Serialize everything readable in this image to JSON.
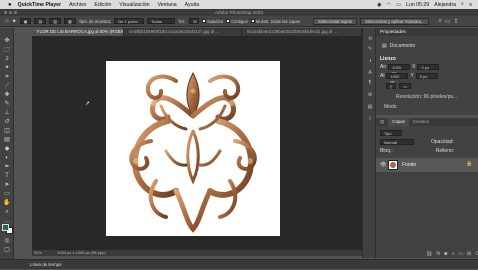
{
  "menubar": {
    "app": "QuickTime Player",
    "items": [
      "Archivo",
      "Edición",
      "Visualización",
      "Ventana",
      "Ayuda"
    ],
    "clock": "Lun 05:29",
    "user": "Alejandra"
  },
  "window": {
    "title": "Adobe Photoshop 2020"
  },
  "options": {
    "size_label": "Tam. de muestra:",
    "size_value": "De 1 punto",
    "sample_label": "Todas",
    "tolerance_label": "Tol.:",
    "tolerance_value": "32",
    "antialias": "Suavizar",
    "contiguous": "Contiguo",
    "sample_all": "Muestr. todas las capas",
    "select_subject": "Seleccionar sujeto",
    "select_mask": "Seleccionar y aplicar máscara..."
  },
  "tabs": [
    {
      "label": "FLOR DE LIS BARROCA.jpg al 50% (RGB/8#) ×"
    },
    {
      "label": "ce49bb1b6989f18cc41a4ae23ad1127.jpg al ..."
    },
    {
      "label": "8ccb4bb4e3129ba83a32b0c6f4dec01.jpg al ..."
    }
  ],
  "status": {
    "zoom": "50%",
    "doc": "1000 px x 1000 px (96 ppp)"
  },
  "timeline": {
    "label": "Línea de tiempo"
  },
  "properties": {
    "title": "Propiedades",
    "doc_label": "Documento",
    "canvas": "Lienzo",
    "width_label": "An",
    "width_value": "1000 px",
    "height_label": "Al",
    "height_value": "1000 px",
    "x_label": "X",
    "y_label": "Y",
    "x_value": "0 px",
    "y_value": "0 px",
    "resolution": "Resolución: 96 píxeles/pu...",
    "mode": "Modo"
  },
  "layers": {
    "tabs": [
      "Capas",
      "Canales"
    ],
    "kind": "Tipo",
    "blend": "Normal",
    "opacity_label": "Opacidad:",
    "lock_label": "Bloq.:",
    "fill_label": "Relleno:",
    "layer_name": "Fondo"
  },
  "colors": {
    "accent": "#2d8ceb",
    "foreground": "#1a6b5a",
    "background": "#ffffff"
  }
}
